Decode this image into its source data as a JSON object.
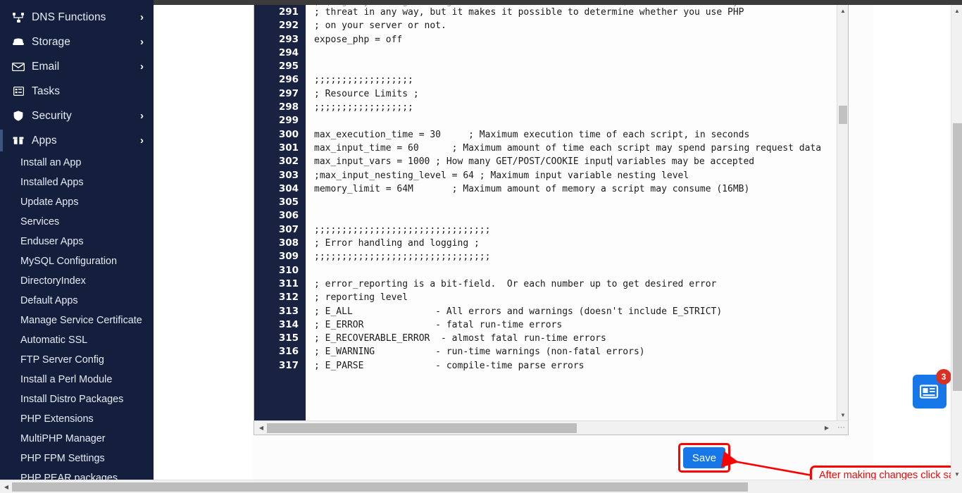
{
  "sidebar": {
    "background_color": "#131f3d",
    "nav": [
      {
        "label": "DNS Functions",
        "icon": "dns-icon",
        "chevron": "›",
        "active": false
      },
      {
        "label": "Storage",
        "icon": "storage-icon",
        "chevron": "›",
        "active": false
      },
      {
        "label": "Email",
        "icon": "email-icon",
        "chevron": "›",
        "active": false
      },
      {
        "label": "Tasks",
        "icon": "tasks-icon",
        "chevron": "",
        "active": false
      },
      {
        "label": "Security",
        "icon": "shield-icon",
        "chevron": "›",
        "active": false
      },
      {
        "label": "Apps",
        "icon": "apps-icon",
        "chevron": "›",
        "active": true
      }
    ],
    "sub_items": [
      {
        "label": "Install an App"
      },
      {
        "label": "Installed Apps"
      },
      {
        "label": "Update Apps"
      },
      {
        "label": "Services"
      },
      {
        "label": "Enduser Apps"
      },
      {
        "label": "MySQL Configuration"
      },
      {
        "label": "DirectoryIndex"
      },
      {
        "label": "Default Apps"
      },
      {
        "label": "Manage Service Certificate"
      },
      {
        "label": "Automatic SSL"
      },
      {
        "label": "FTP Server Config"
      },
      {
        "label": "Install a Perl Module"
      },
      {
        "label": "Install Distro Packages"
      },
      {
        "label": "PHP Extensions"
      },
      {
        "label": "MultiPHP Manager"
      },
      {
        "label": "PHP FPM Settings"
      },
      {
        "label": "PHP PEAR packages"
      }
    ]
  },
  "editor": {
    "first_line_number": 291,
    "gutter_color": "#1a2242",
    "line_numbers": [
      291,
      292,
      293,
      294,
      295,
      296,
      297,
      298,
      299,
      300,
      301,
      302,
      303,
      304,
      305,
      306,
      307,
      308,
      309,
      310,
      311,
      312,
      313,
      314,
      315,
      316,
      317
    ],
    "lines": [
      "; threat in any way, but it makes it possible to determine whether you use PHP",
      "; on your server or not.",
      "expose_php = off",
      "",
      "",
      ";;;;;;;;;;;;;;;;;;",
      "; Resource Limits ;",
      ";;;;;;;;;;;;;;;;;;",
      "",
      "max_execution_time = 30     ; Maximum execution time of each script, in seconds",
      "max_input_time = 60      ; Maximum amount of time each script may spend parsing request data",
      "",
      ";max_input_nesting_level = 64 ; Maximum input variable nesting level",
      "memory_limit = 64M       ; Maximum amount of memory a script may consume (16MB)",
      "",
      "",
      ";;;;;;;;;;;;;;;;;;;;;;;;;;;;;;;;",
      "; Error handling and logging ;",
      ";;;;;;;;;;;;;;;;;;;;;;;;;;;;;;;;",
      "",
      "; error_reporting is a bit-field.  Or each number up to get desired error",
      "; reporting level",
      "; E_ALL               - All errors and warnings (doesn't include E_STRICT)",
      "; E_ERROR             - fatal run-time errors",
      "; E_RECOVERABLE_ERROR  - almost fatal run-time errors",
      "; E_WARNING           - run-time warnings (non-fatal errors)",
      "; E_PARSE             - compile-time parse errors"
    ],
    "caret_line_prefix": "max_input_vars = 1000 ; How many GET/POST/COOKIE input",
    "caret_line_suffix": " variables may be accepted"
  },
  "actions": {
    "save_label": "Save",
    "save_color": "#1577e8",
    "highlight_color": "#ff0000"
  },
  "annotation": {
    "text": "After making changes click save",
    "color": "#ff0000"
  },
  "news_widget": {
    "icon": "news-icon",
    "badge_count": "3",
    "badge_color": "#d93025",
    "background_color": "#1577e8"
  },
  "scrollbars": {
    "arrow_up": "▲",
    "arrow_down": "▼",
    "arrow_left": "◀",
    "arrow_right": "▶",
    "grip": "╱╱"
  }
}
